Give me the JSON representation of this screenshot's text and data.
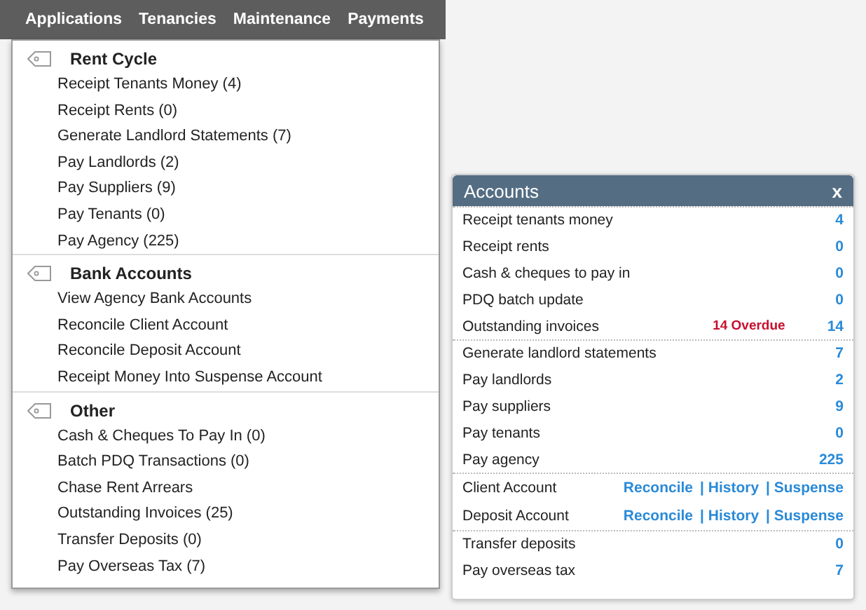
{
  "menu_bar": [
    "Applications",
    "Tenancies",
    "Maintenance",
    "Payments"
  ],
  "dropdown": [
    {
      "title": "Rent Cycle",
      "items": [
        "Receipt Tenants Money (4)",
        "Receipt Rents (0)",
        "Generate Landlord Statements (7)",
        "Pay Landlords (2)",
        "Pay Suppliers (9)",
        "Pay Tenants (0)",
        "Pay Agency (225)"
      ]
    },
    {
      "title": "Bank Accounts",
      "items": [
        "View Agency Bank Accounts",
        "Reconcile Client Account",
        "Reconcile Deposit Account",
        "Receipt Money Into Suspense Account"
      ]
    },
    {
      "title": "Other",
      "items": [
        "Cash & Cheques To Pay In (0)",
        "Batch PDQ Transactions (0)",
        "Chase Rent Arrears",
        "Outstanding Invoices (25)",
        "Transfer Deposits (0)",
        "Pay Overseas Tax (7)"
      ]
    }
  ],
  "accounts_panel": {
    "title": "Accounts",
    "close": "x",
    "sections": [
      [
        {
          "kind": "count",
          "label": "Receipt tenants money",
          "count": "4"
        },
        {
          "kind": "count",
          "label": "Receipt rents",
          "count": "0"
        },
        {
          "kind": "count",
          "label": "Cash & cheques to pay in",
          "count": "0"
        },
        {
          "kind": "count",
          "label": "PDQ batch update",
          "count": "0"
        },
        {
          "kind": "count",
          "label": "Outstanding invoices",
          "note": "14 Overdue",
          "count": "14"
        }
      ],
      [
        {
          "kind": "count",
          "label": "Generate landlord statements",
          "count": "7"
        },
        {
          "kind": "count",
          "label": "Pay landlords",
          "count": "2"
        },
        {
          "kind": "count",
          "label": "Pay suppliers",
          "count": "9"
        },
        {
          "kind": "count",
          "label": "Pay tenants",
          "count": "0"
        },
        {
          "kind": "count",
          "label": "Pay agency",
          "count": "225"
        }
      ],
      [
        {
          "kind": "links",
          "label": "Client Account",
          "links": [
            "Reconcile",
            "| History",
            "| Suspense"
          ]
        },
        {
          "kind": "links",
          "label": "Deposit Account",
          "links": [
            "Reconcile",
            "| History",
            "| Suspense"
          ]
        }
      ],
      [
        {
          "kind": "count",
          "label": "Transfer deposits",
          "count": "0"
        },
        {
          "kind": "count",
          "label": "Pay overseas tax",
          "count": "7"
        }
      ]
    ]
  }
}
